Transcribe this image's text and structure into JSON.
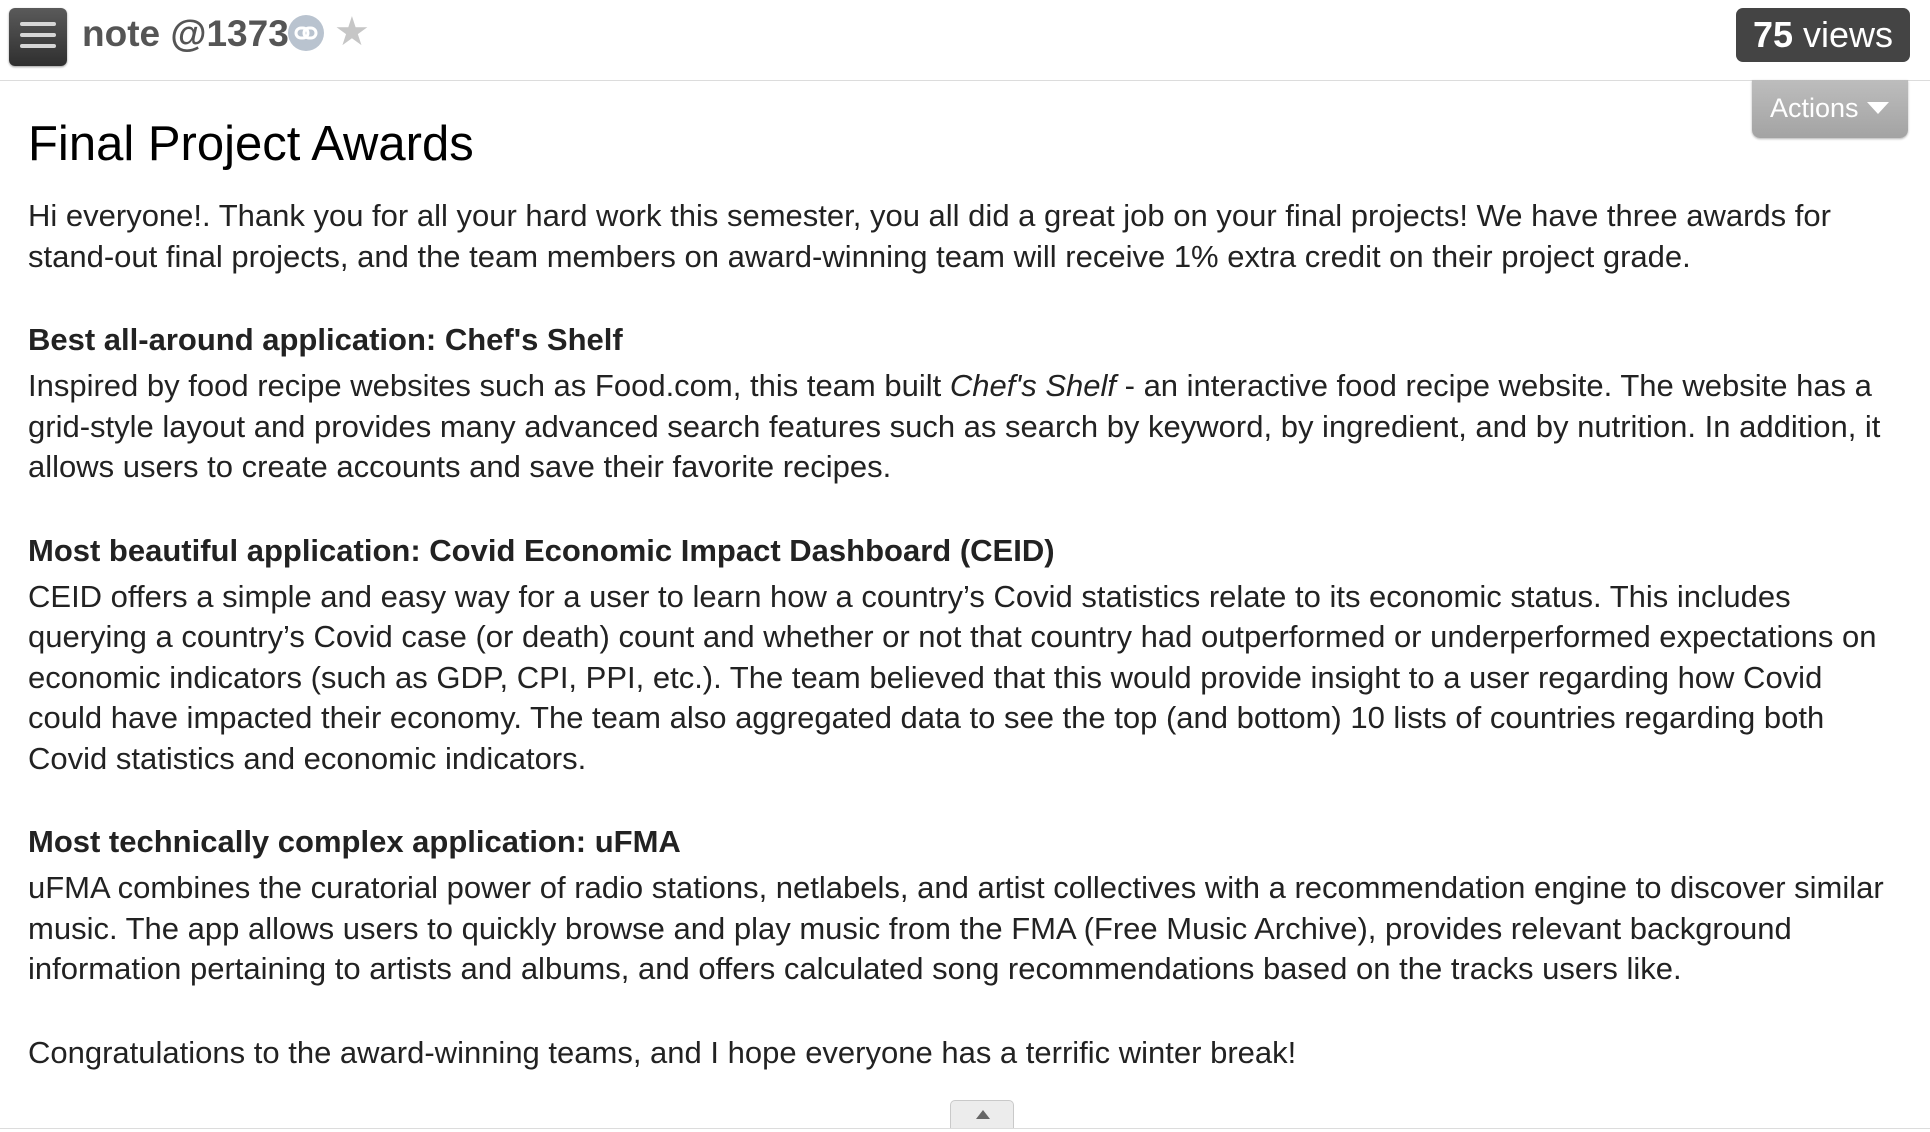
{
  "header": {
    "note_title": "note @1373",
    "views_count": "75",
    "views_label": "views",
    "icons": {
      "menu": "menu-icon",
      "link": "link-icon",
      "star": "star-icon"
    }
  },
  "actions": {
    "label": "Actions"
  },
  "post": {
    "title": "Final Project Awards",
    "intro": "Hi everyone!. Thank you for all your hard work this semester, you all did a great job on your final projects! We have three awards for stand-out final projects, and the team members on award-winning team will receive 1% extra credit on their project grade.",
    "sections": [
      {
        "heading": "Best all-around application: Chef's Shelf",
        "body_before": "Inspired by food recipe websites such as Food.com, this team built ",
        "body_emph": "Chef's Shelf",
        "body_after": " - an interactive food recipe website. The website has a grid-style layout and provides many advanced search features such as search by keyword, by ingredient, and by nutrition. In addition, it allows users to create accounts and save their favorite recipes."
      },
      {
        "heading": "Most beautiful application: Covid Economic Impact Dashboard (CEID)",
        "body": "CEID offers a simple and easy way for a user to learn how a country’s Covid statistics relate to its economic status. This includes querying a country’s Covid case (or death) count and whether or not that country had outperformed or underperformed expectations on economic indicators (such as GDP, CPI, PPI, etc.). The team believed that this would provide insight to a user regarding how Covid could have impacted their economy. The team also aggregated data to see the top (and bottom) 10 lists of countries regarding both Covid statistics and economic indicators."
      },
      {
        "heading": "Most technically complex application: uFMA",
        "body": "uFMA combines the curatorial power of radio stations, netlabels, and artist collectives with a recommendation engine to discover similar music. The app allows users to quickly browse and play music from the FMA (Free Music Archive), provides relevant background information pertaining to artists and albums, and offers calculated song recommendations based on the tracks users like."
      }
    ],
    "closing": "Congratulations to the award-winning teams, and I hope everyone has a terrific winter break!"
  },
  "colors": {
    "badge_bg": "#444444",
    "actions_bg": "#b0b0b0",
    "title_gray": "#555555",
    "star_gray": "#c6c6c6"
  }
}
